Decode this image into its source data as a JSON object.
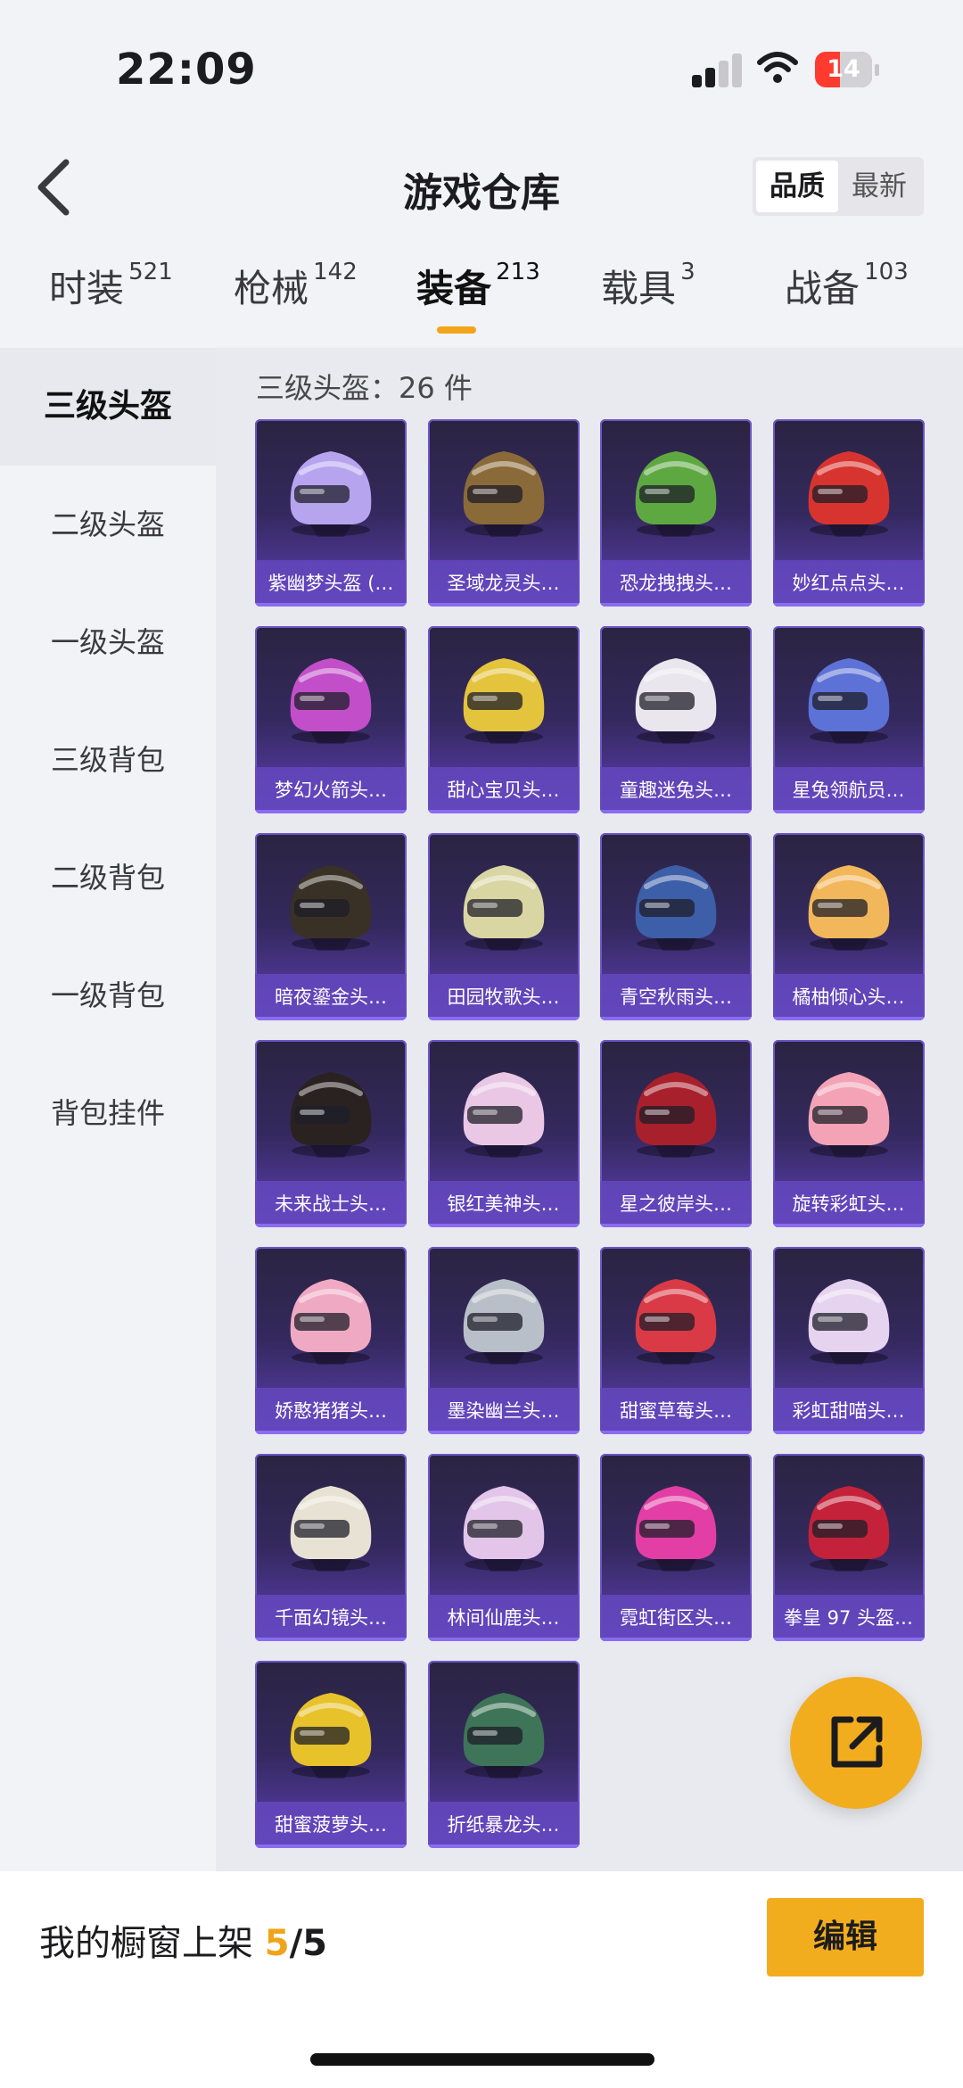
{
  "status_bar": {
    "time": "22:09",
    "battery": "14"
  },
  "header": {
    "title": "游戏仓库",
    "sort_options": [
      "品质",
      "最新"
    ]
  },
  "category_tabs": [
    {
      "label": "时装",
      "count": "521"
    },
    {
      "label": "枪械",
      "count": "142"
    },
    {
      "label": "装备",
      "count": "213",
      "active": true
    },
    {
      "label": "载具",
      "count": "3"
    },
    {
      "label": "战备",
      "count": "103"
    }
  ],
  "sidebar": {
    "items": [
      "三级头盔",
      "二级头盔",
      "一级头盔",
      "三级背包",
      "二级背包",
      "一级背包",
      "背包挂件"
    ],
    "active_index": 0
  },
  "section": {
    "header": "三级头盔：26 件"
  },
  "items": [
    {
      "name": "紫幽梦头盔 (…",
      "icon": "helmet-icon",
      "color": "#b7a4ef"
    },
    {
      "name": "圣域龙灵头…",
      "icon": "helmet-icon",
      "color": "#8b6a3a"
    },
    {
      "name": "恐龙拽拽头…",
      "icon": "helmet-icon",
      "color": "#5ea842"
    },
    {
      "name": "妙红点点头…",
      "icon": "helmet-icon",
      "color": "#d8342f"
    },
    {
      "name": "梦幻火箭头…",
      "icon": "helmet-icon",
      "color": "#c24fc9"
    },
    {
      "name": "甜心宝贝头…",
      "icon": "helmet-icon",
      "color": "#e3c43c"
    },
    {
      "name": "童趣迷兔头…",
      "icon": "helmet-icon",
      "color": "#e9e6ee"
    },
    {
      "name": "星兔领航员…",
      "icon": "helmet-icon",
      "color": "#5d72d6"
    },
    {
      "name": "暗夜鎏金头…",
      "icon": "helmet-icon",
      "color": "#3a3126"
    },
    {
      "name": "田园牧歌头…",
      "icon": "helmet-icon",
      "color": "#d9d6a4"
    },
    {
      "name": "青空秋雨头…",
      "icon": "helmet-icon",
      "color": "#3d5ea8"
    },
    {
      "name": "橘柚倾心头…",
      "icon": "helmet-icon",
      "color": "#f2b75a"
    },
    {
      "name": "未来战士头…",
      "icon": "helmet-icon",
      "color": "#2a2220"
    },
    {
      "name": "银红美神头…",
      "icon": "helmet-icon",
      "color": "#e9c7e5"
    },
    {
      "name": "星之彼岸头…",
      "icon": "helmet-icon",
      "color": "#a8202c"
    },
    {
      "name": "旋转彩虹头…",
      "icon": "helmet-icon",
      "color": "#f3a3b5"
    },
    {
      "name": "娇憨猪猪头…",
      "icon": "helmet-icon",
      "color": "#f0a9c3"
    },
    {
      "name": "墨染幽兰头…",
      "icon": "helmet-icon",
      "color": "#b9bfc9"
    },
    {
      "name": "甜蜜草莓头…",
      "icon": "helmet-icon",
      "color": "#d93a45"
    },
    {
      "name": "彩虹甜喵头…",
      "icon": "helmet-icon",
      "color": "#e6d3ef"
    },
    {
      "name": "千面幻镜头…",
      "icon": "helmet-icon",
      "color": "#e8e2d4"
    },
    {
      "name": "林间仙鹿头…",
      "icon": "helmet-icon",
      "color": "#e2c5e8"
    },
    {
      "name": "霓虹街区头…",
      "icon": "helmet-icon",
      "color": "#e23ea5"
    },
    {
      "name": "拳皇 97 头盔…",
      "icon": "helmet-icon",
      "color": "#c4213a"
    },
    {
      "name": "甜蜜菠萝头…",
      "icon": "helmet-icon",
      "color": "#e7c22a"
    },
    {
      "name": "折纸暴龙头…",
      "icon": "helmet-icon",
      "color": "#3e7458"
    }
  ],
  "bottom_bar": {
    "label": "我的橱窗上架",
    "current": "5",
    "total": "/5",
    "edit_label": "编辑"
  },
  "colors": {
    "accent": "#f2ad1f",
    "card_top": "#2a2441",
    "card_bottom": "#5e3fb5"
  }
}
